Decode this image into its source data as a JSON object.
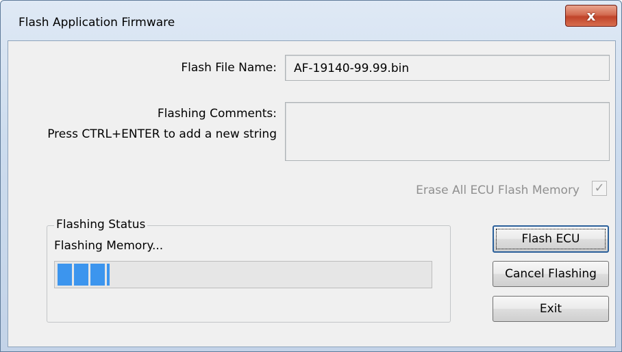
{
  "window": {
    "title": "Flash Application Firmware",
    "close_glyph": "x"
  },
  "form": {
    "flash_file_label": "Flash File Name:",
    "flash_file_value": "AF-19140-99.99.bin",
    "comments_label": "Flashing Comments:",
    "comments_hint": "Press CTRL+ENTER to add a new string",
    "comments_value": "",
    "erase_label": "Erase All ECU Flash Memory",
    "erase_checked": true,
    "erase_enabled": false
  },
  "status": {
    "group_label": "Flashing Status",
    "message": "Flashing Memory...",
    "progress_percent": 14,
    "progress_color": "#3c95ee"
  },
  "buttons": {
    "flash_ecu": "Flash ECU",
    "cancel_flashing": "Cancel Flashing",
    "exit": "Exit"
  }
}
